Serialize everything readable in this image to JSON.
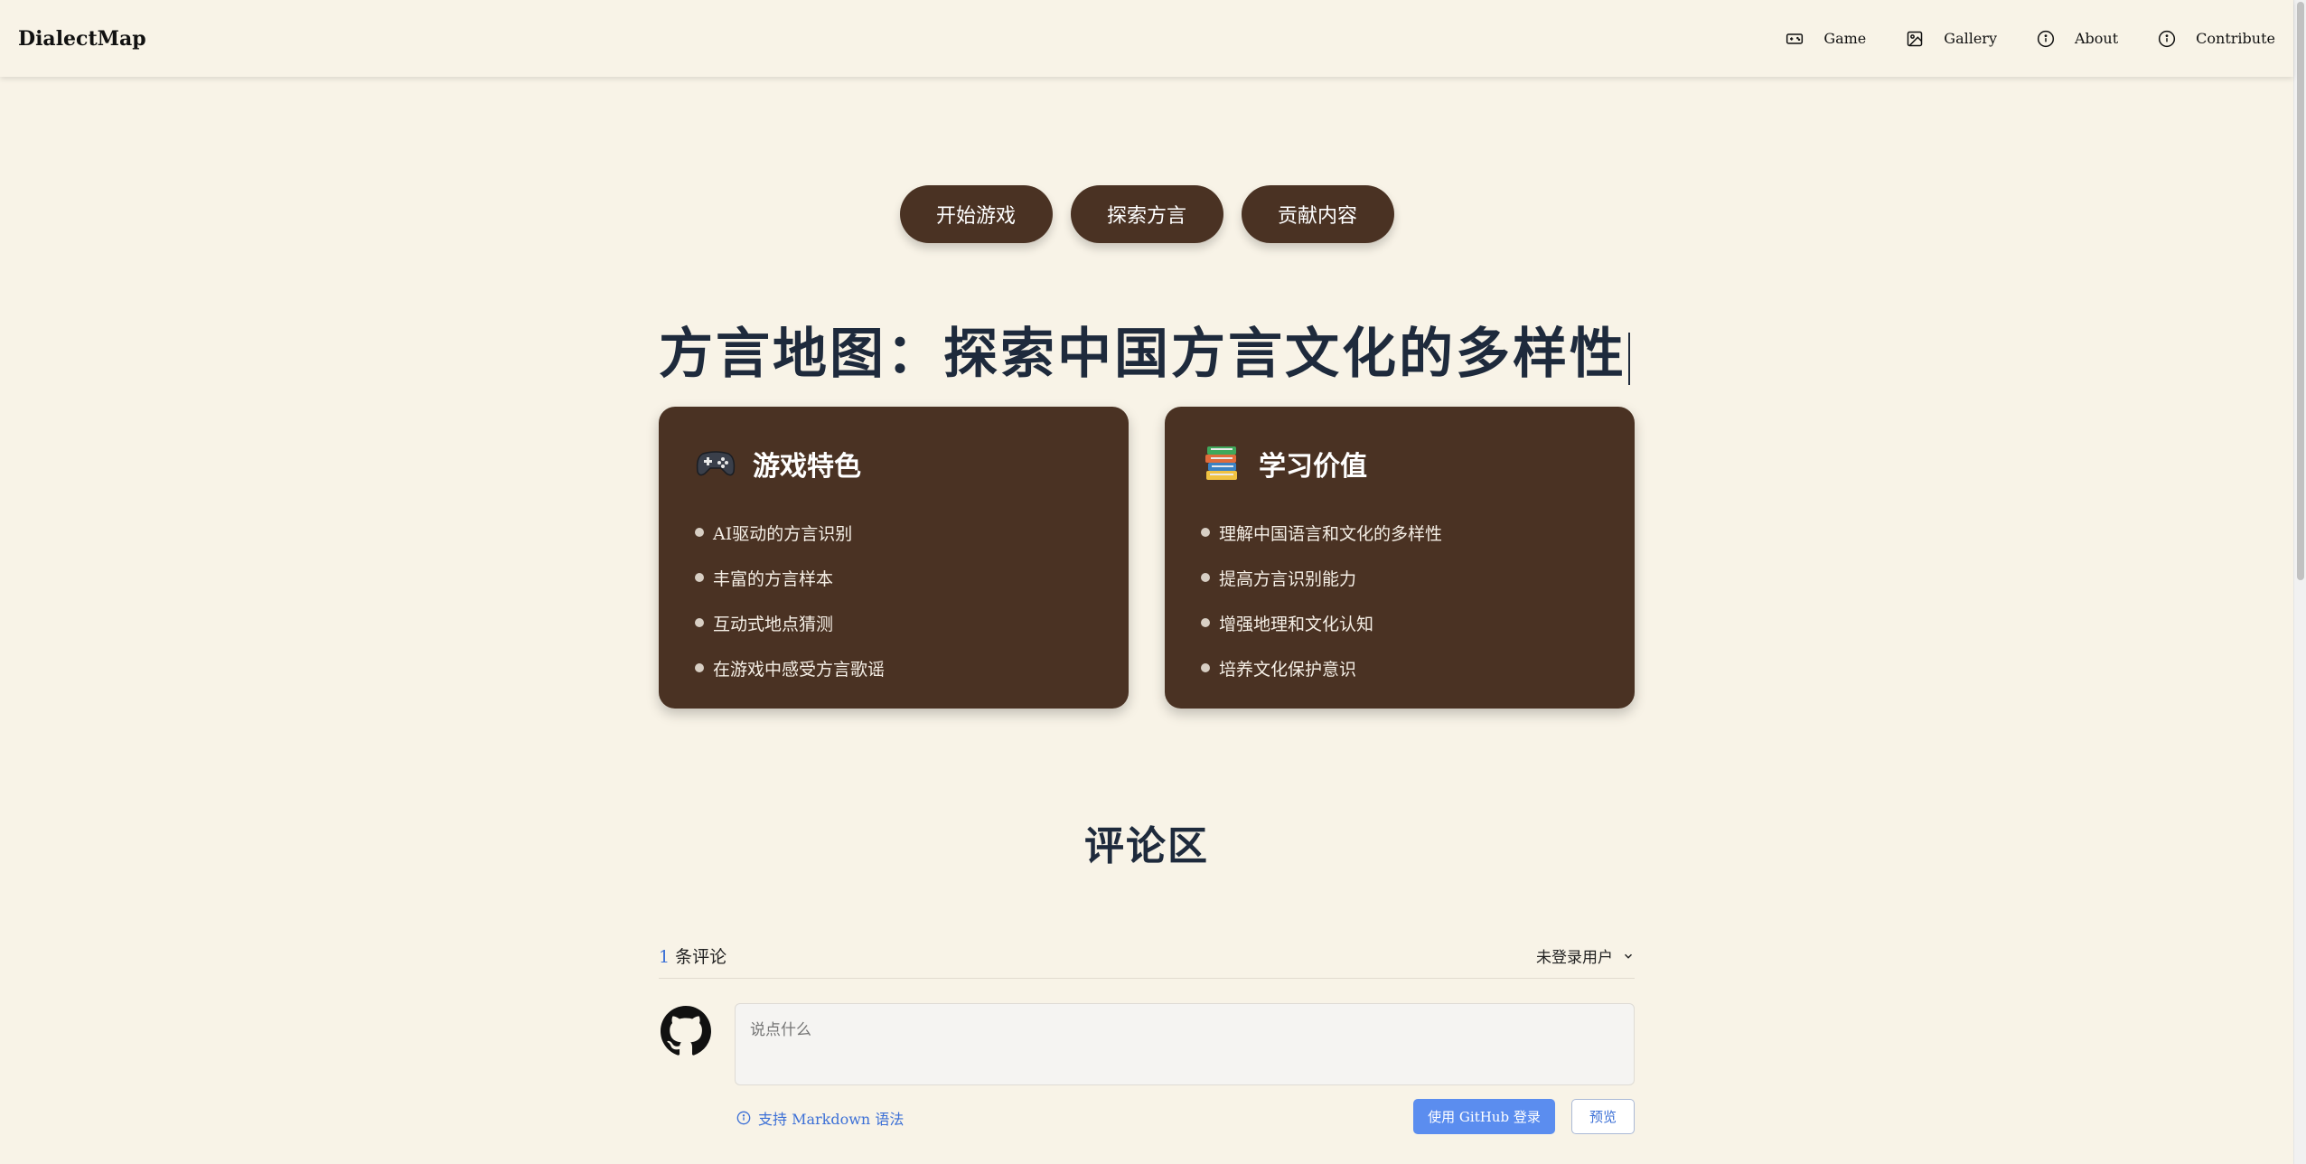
{
  "header": {
    "brand": "DialectMap",
    "nav": [
      {
        "label": "Game",
        "icon": "gamepad-icon"
      },
      {
        "label": "Gallery",
        "icon": "image-icon"
      },
      {
        "label": "About",
        "icon": "info-icon"
      },
      {
        "label": "Contribute",
        "icon": "info-icon"
      }
    ]
  },
  "hero": {
    "buttons": [
      "开始游戏",
      "探索方言",
      "贡献内容"
    ],
    "title": "方言地图：探索中国方言文化的多样性"
  },
  "cards": [
    {
      "icon": "game-controller-emoji",
      "title": "游戏特色",
      "items": [
        "AI驱动的方言识别",
        "丰富的方言样本",
        "互动式地点猜测",
        "在游戏中感受方言歌谣"
      ]
    },
    {
      "icon": "books-emoji",
      "title": "学习价值",
      "items": [
        "理解中国语言和文化的多样性",
        "提高方言识别能力",
        "增强地理和文化认知",
        "培养文化保护意识"
      ]
    }
  ],
  "comments": {
    "title": "评论区",
    "count": "1",
    "count_label": "条评论",
    "user_menu": "未登录用户",
    "placeholder": "说点什么",
    "markdown_hint": "支持 Markdown 语法",
    "login_button": "使用 GitHub 登录",
    "preview_button": "预览"
  },
  "colors": {
    "background": "#f8f3e7",
    "accent_brown": "#4a3223",
    "link_blue": "#3b6fd6",
    "login_blue": "#5b8def"
  }
}
